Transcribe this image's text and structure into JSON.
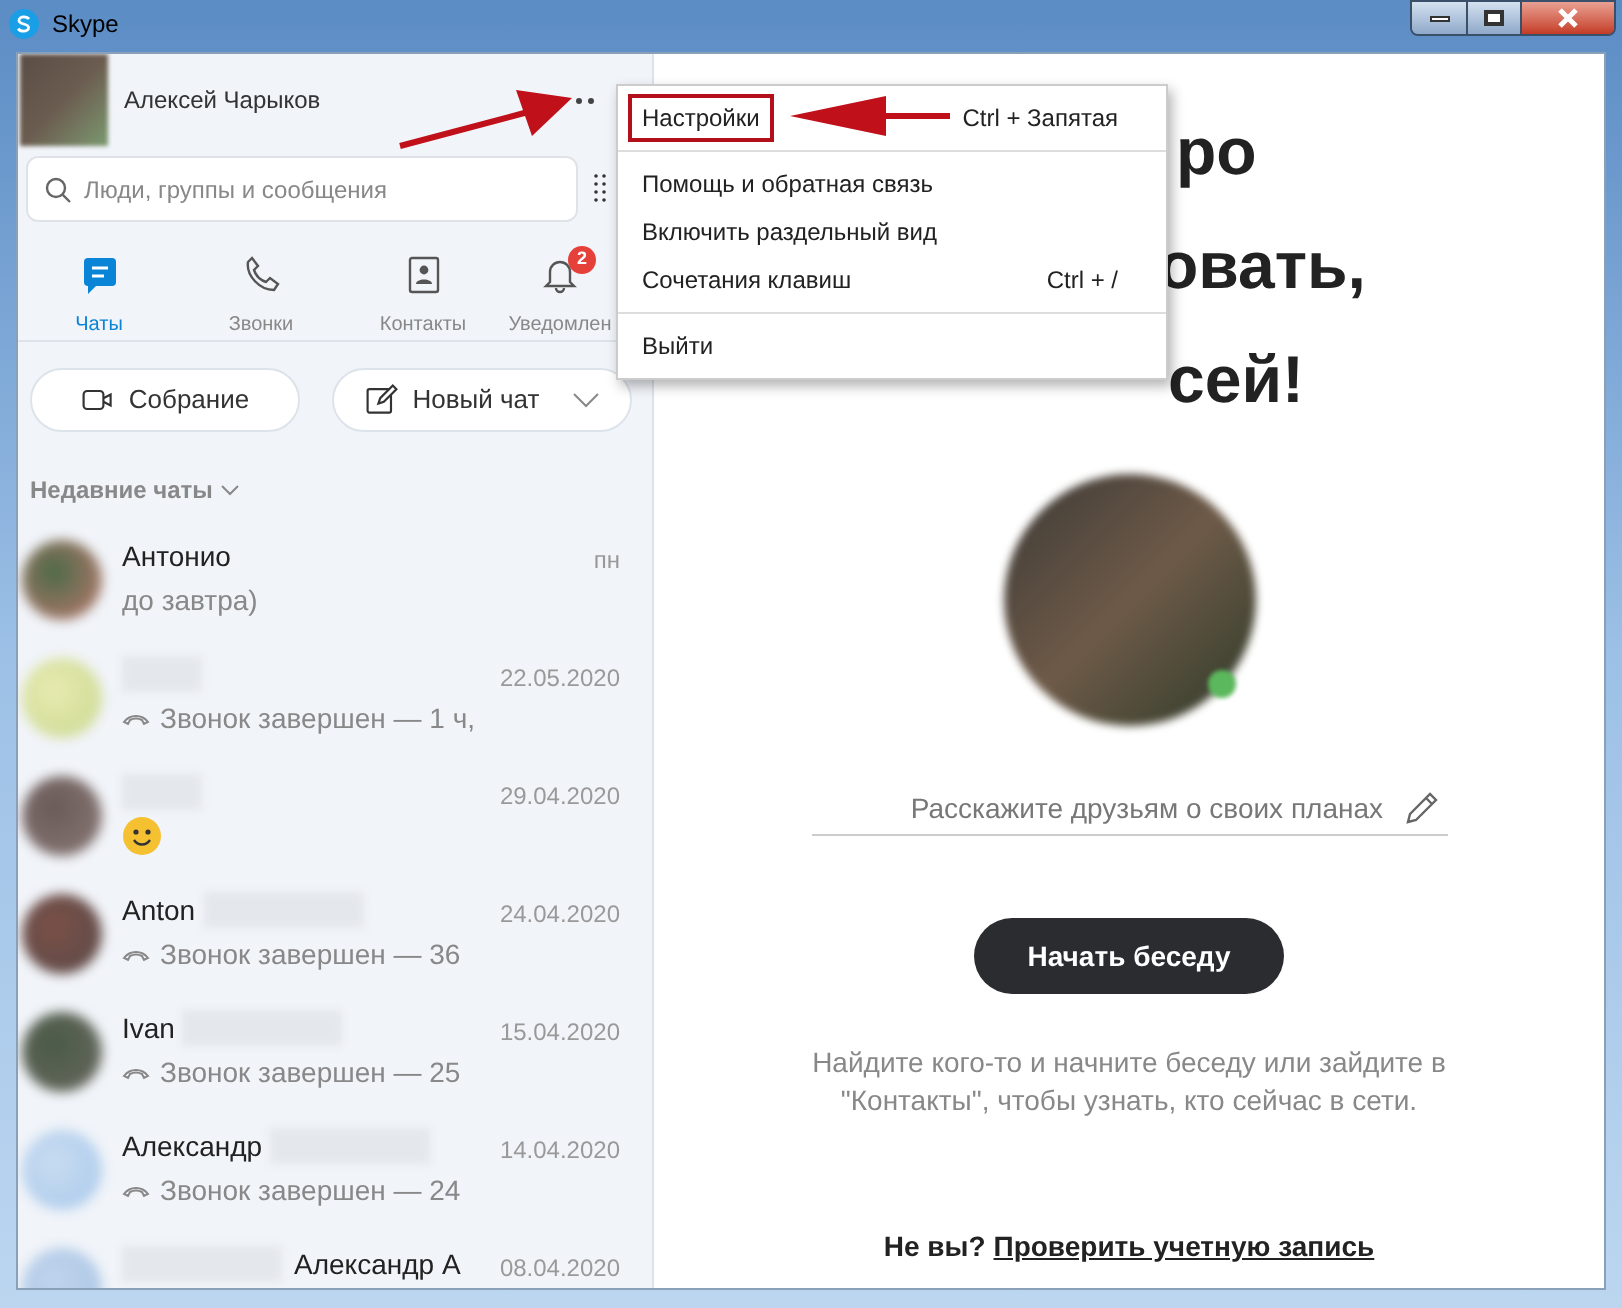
{
  "window": {
    "title": "Skype"
  },
  "profile": {
    "name": "Алексей Чарыков"
  },
  "search": {
    "placeholder": "Люди, группы и сообщения"
  },
  "tabs": [
    {
      "label": "Чаты",
      "selected": true
    },
    {
      "label": "Звонки",
      "selected": false
    },
    {
      "label": "Контакты",
      "selected": false
    },
    {
      "label": "Уведомлен",
      "selected": false,
      "badge": "2"
    }
  ],
  "actions": [
    {
      "label": "Собрание"
    },
    {
      "label": "Новый чат"
    }
  ],
  "recent_header": "Недавние чаты",
  "chats": [
    {
      "name": "Антонио",
      "name_blurred": false,
      "time": "пн",
      "preview": {
        "kind": "text",
        "text": "до завтра)"
      }
    },
    {
      "name_blurred": true,
      "time": "22.05.2020",
      "preview": {
        "kind": "call",
        "text": "Звонок завершен — 1 ч,"
      }
    },
    {
      "name_blurred": true,
      "time": "29.04.2020",
      "preview": {
        "kind": "emoji"
      }
    },
    {
      "name": "Anton",
      "name_blurred": true,
      "time": "24.04.2020",
      "preview": {
        "kind": "call",
        "text": "Звонок завершен — 36"
      }
    },
    {
      "name": "Ivan",
      "name_blurred": true,
      "time": "15.04.2020",
      "preview": {
        "kind": "call",
        "text": "Звонок завершен — 25"
      }
    },
    {
      "name": "Александр",
      "name_blurred": true,
      "time": "14.04.2020",
      "preview": {
        "kind": "call",
        "text": "Звонок завершен — 24"
      }
    },
    {
      "name": "Александр А",
      "name_blurred": true,
      "time": "08.04.2020"
    }
  ],
  "menu": {
    "items": [
      {
        "label": "Настройки",
        "shortcut": "Ctrl + Запятая",
        "highlighted": true
      },
      {
        "label": "Помощь и обратная связь",
        "highlighted": false
      },
      {
        "label": "Включить раздельный вид",
        "highlighted": false
      },
      {
        "label": "Сочетания клавиш",
        "shortcut": "Ctrl + /",
        "highlighted": false
      },
      {
        "label": "Выйти",
        "highlighted": false
      }
    ]
  },
  "welcome": {
    "heading_lines": [
      "ро",
      "овать,",
      "сей!"
    ],
    "status_placeholder": "Расскажите друзьям о своих планах",
    "start_button": "Начать беседу",
    "hint": "Найдите кого-то и начните беседу или зайдите в \"Контакты\", чтобы узнать, кто сейчас в сети.",
    "footer_question": "Не вы?",
    "footer_link": "Проверить учетную запись"
  }
}
